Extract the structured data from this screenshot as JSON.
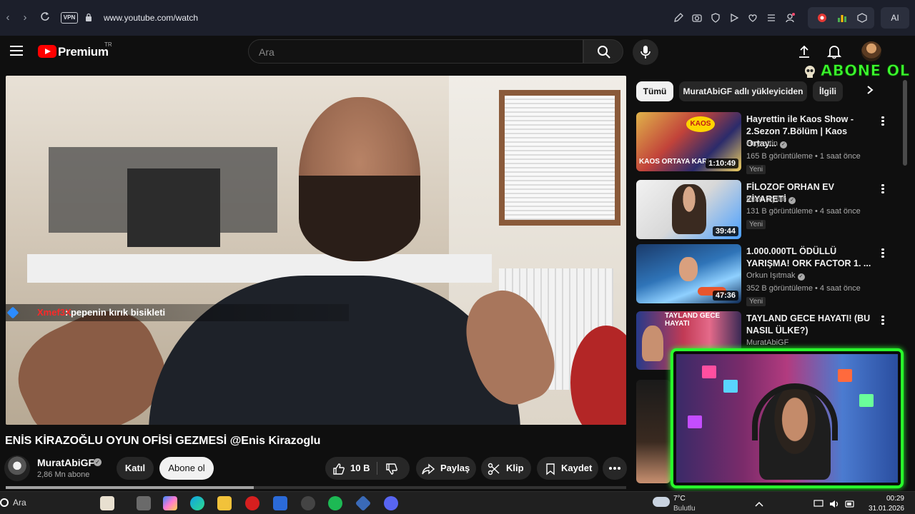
{
  "browser": {
    "url": "www.youtube.com/watch",
    "vpn_label": "VPN",
    "ai_label": "AI"
  },
  "header": {
    "brand": "Premium",
    "country": "TR",
    "search_placeholder": "Ara"
  },
  "overlay": {
    "abone_text": "ABONE OL"
  },
  "player": {
    "chat_user": "Xmef3X",
    "chat_message": ": pepenin kırık bisikleti",
    "progress_fraction": 0.4
  },
  "video": {
    "title": "ENİS KİRAZOĞLU OYUN OFİSİ GEZMESİ @Enis Kirazoglu",
    "channel": "MuratAbiGF",
    "subscribers": "2,86 Mn abone",
    "join_label": "Katıl",
    "subscribe_label": "Abone ol",
    "likes": "10 B",
    "share_label": "Paylaş",
    "clip_label": "Klip",
    "save_label": "Kaydet"
  },
  "chips": [
    "Tümü",
    "MuratAbiGF adlı yükleyiciden",
    "İlgili"
  ],
  "recommendations": [
    {
      "title": "Hayrettin ile Kaos Show - 2.Sezon 7.Bölüm | Kaos Ortay...",
      "channel": "Hayrettin",
      "meta": "165 B görüntüleme • 1 saat önce",
      "badge": "Yeni",
      "duration": "1:10:49",
      "thumb_text": "KAOS ORTAYA KARI"
    },
    {
      "title": "FİLOZOF ORHAN EV ZİYARETİ",
      "channel": "testo taylan",
      "meta": "131 B görüntüleme • 4 saat önce",
      "badge": "Yeni",
      "duration": "39:44"
    },
    {
      "title": "1.000.000TL ÖDÜLLÜ YARIŞMA! ORK FACTOR 1. ...",
      "channel": "Orkun Işıtmak",
      "meta": "352 B görüntüleme • 4 saat önce",
      "badge": "Yeni",
      "duration": "47:36"
    },
    {
      "title": "TAYLAND GECE HAYATI! (BU NASIL ÜLKE?)",
      "channel": "MuratAbiGF",
      "thumb_text": "TAYLAND GECE HAYATI"
    }
  ],
  "taskbar": {
    "search_label": "Ara",
    "temperature": "7°C",
    "condition": "Bulutlu",
    "time": "00:29",
    "date": "31.01.2026"
  },
  "colors": {
    "yt_red": "#ff0000",
    "abone_green": "#3dff2f",
    "cam_border": "#28ff2b"
  }
}
